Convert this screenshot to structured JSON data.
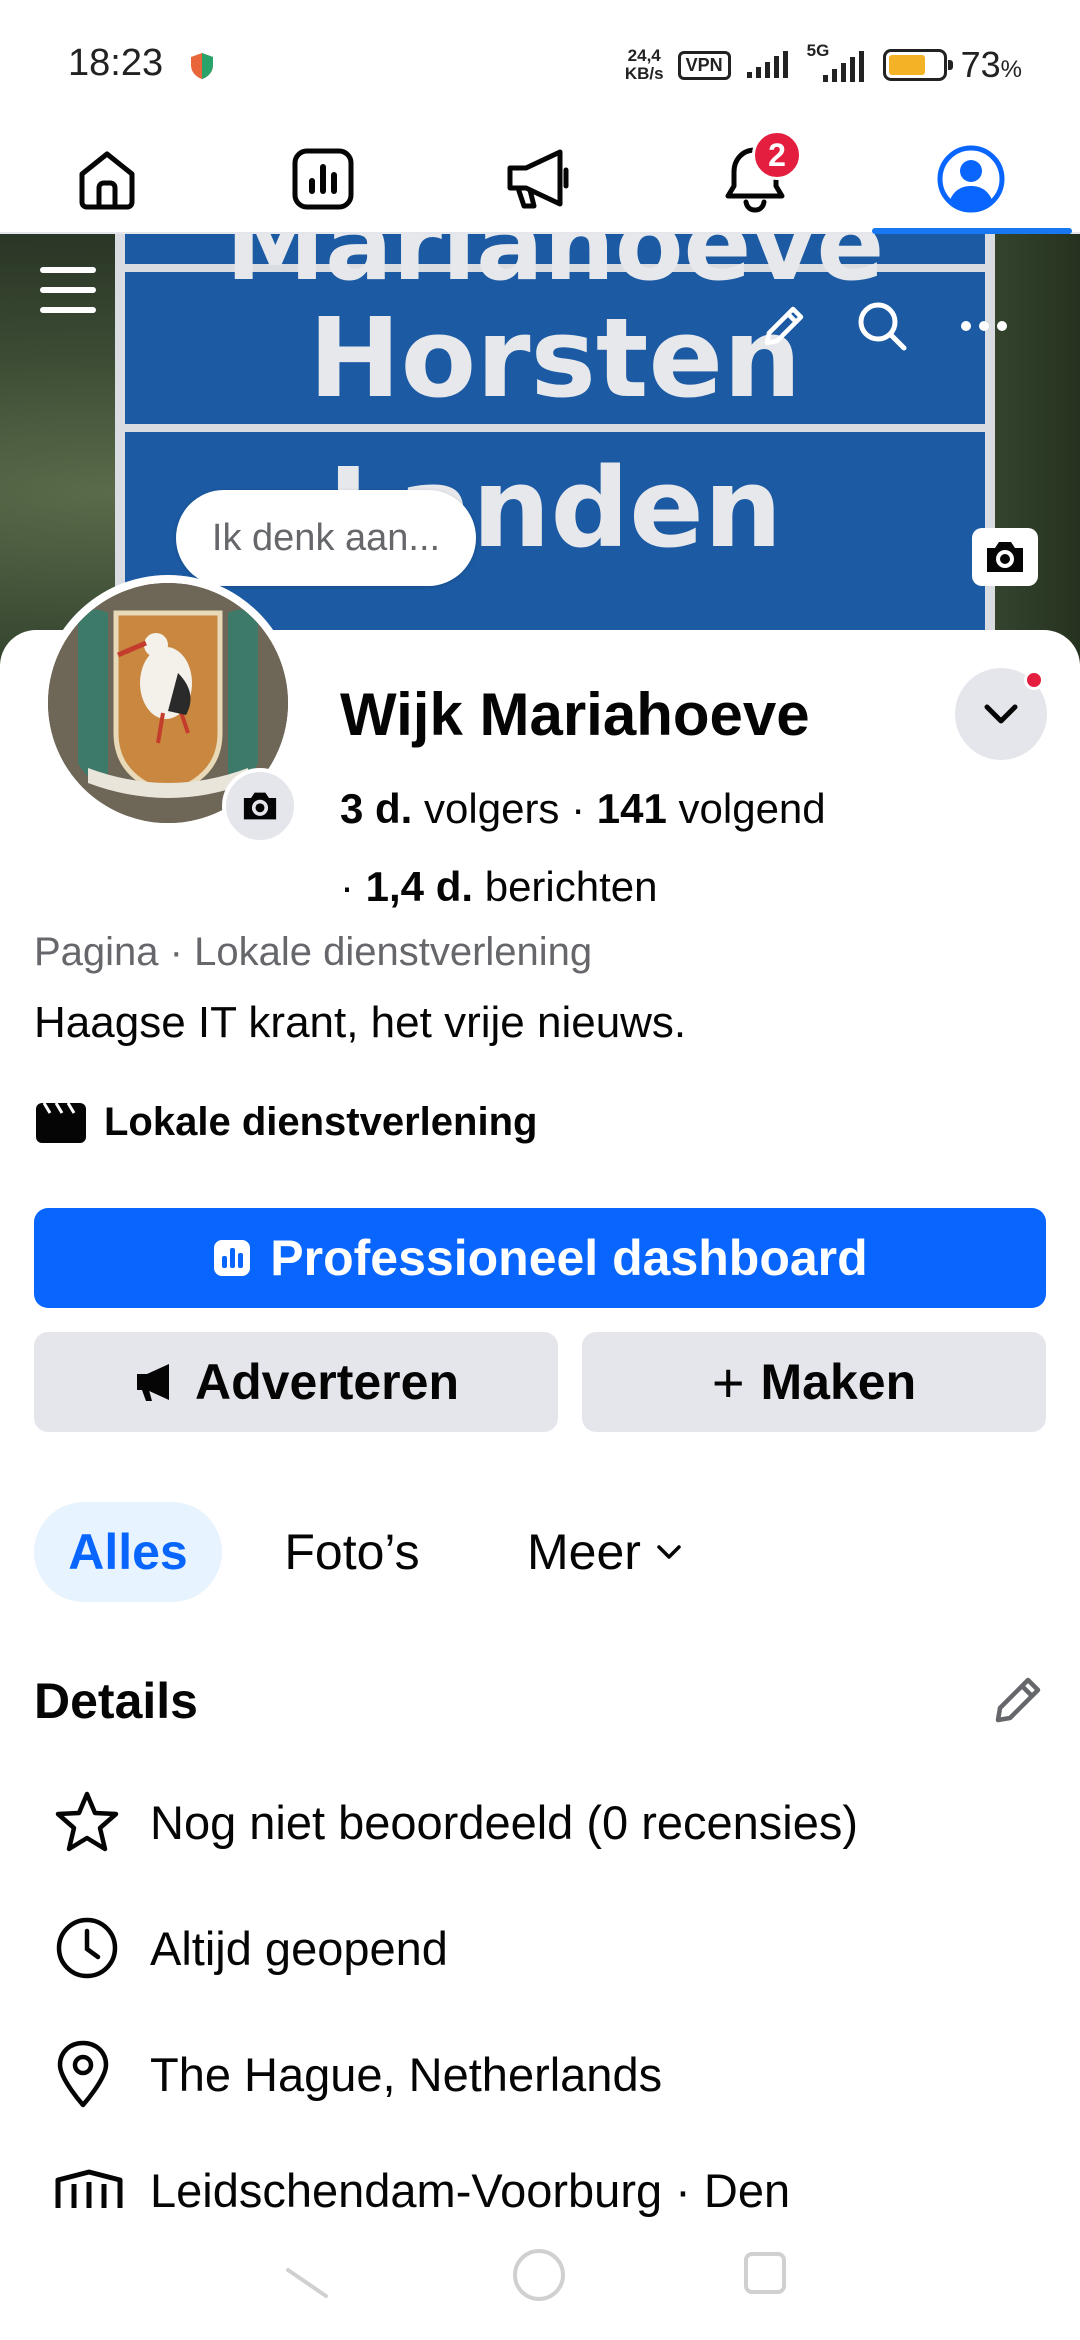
{
  "status_bar": {
    "time": "18:23",
    "net_speed_value": "24,4",
    "net_speed_unit": "KB/s",
    "vpn_label": "VPN",
    "network_type": "5G",
    "battery_percent": "73",
    "battery_suffix": "%",
    "battery_level": 0.73
  },
  "top_nav": {
    "items": [
      "home-icon",
      "dashboard-icon",
      "megaphone-icon",
      "bell-icon",
      "profile-icon"
    ],
    "notification_count": "2",
    "active_item": "profile"
  },
  "cover": {
    "sign_lines": [
      "Mariahoeve",
      "Horsten",
      "Landen"
    ],
    "status_prompt": "Ik denk aan..."
  },
  "profile": {
    "name": "Wijk Mariahoeve",
    "followers_value": "3 d.",
    "followers_label": "volgers",
    "following_value": "141",
    "following_label": "volgend",
    "posts_value": "1,4 d.",
    "posts_label": "berichten",
    "category_type": "Pagina",
    "category_name": "Lokale dienstverlening",
    "bio": "Haagse IT krant, het vrije nieuws.",
    "category_label": "Lokale dienstverlening"
  },
  "actions": {
    "primary": "Professioneel dashboard",
    "advertise": "Adverteren",
    "create": "Maken",
    "create_prefix": "+"
  },
  "tabs": {
    "all": "Alles",
    "photos": "Foto’s",
    "more": "Meer"
  },
  "details": {
    "title": "Details",
    "rating": "Nog niet beoordeeld (0 recensies)",
    "hours": "Altijd geopend",
    "location": "The Hague, Netherlands",
    "area": "Leidschendam-Voorburg · Den"
  },
  "colors": {
    "accent": "#0866ff",
    "badge": "#e41e3f",
    "secondary_button": "#e4e6eb",
    "muted_text": "#65676b"
  }
}
